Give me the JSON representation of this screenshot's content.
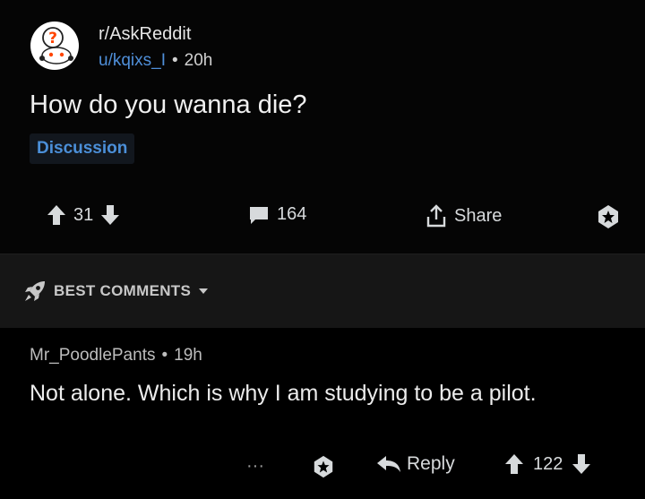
{
  "post": {
    "subreddit": "r/AskReddit",
    "author": "u/kqixs_I",
    "separator": "•",
    "age": "20h",
    "title": "How do you wanna die?",
    "flair": "Discussion",
    "vote_count": "31",
    "comment_count": "164",
    "share_label": "Share"
  },
  "sort": {
    "label": "BEST COMMENTS"
  },
  "comment": {
    "author": "Mr_PoodlePants",
    "separator": "•",
    "age": "19h",
    "body": "Not alone.  Which is why I am studying to be a pilot.",
    "more_label": "···",
    "reply_label": "Reply",
    "vote_count": "122"
  }
}
